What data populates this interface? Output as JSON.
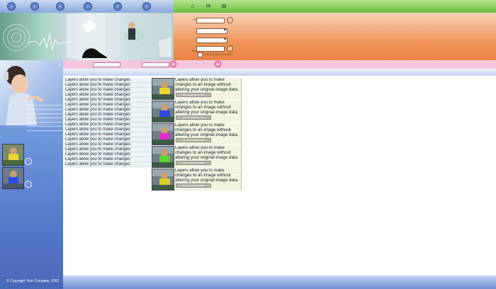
{
  "top_nav": {
    "left_icons": [
      "circle-arrow-icon",
      "circle-arrow-icon",
      "circle-arrow-icon",
      "circle-arrow-icon",
      "circle-arrow-icon",
      "circle-arrow-icon"
    ],
    "right_icons": [
      "home-icon",
      "mail-icon",
      "sitemap-icon"
    ]
  },
  "search_panel": {
    "search_label": "SEARCH",
    "genre_label": "GENRE",
    "letter_label": "LETTER",
    "subscribe_label": "SUBSCRIBE",
    "unsubscribe_label": "UNSUBSCRIBE",
    "search_value": "",
    "genre_selected": "",
    "letter_selected": "",
    "subscribe_value": ""
  },
  "pink_bar": {
    "field1_value": "",
    "field2_value": "",
    "field3_label": ""
  },
  "list": {
    "items": [
      "Layers allow you to make changes",
      "Layers allow you to make changes",
      "Layers allow you to make changes",
      "Layers allow you to make changes",
      "Layers allow you to make changes",
      "Layers allow you to make changes",
      "Layers allow you to make changes",
      "Layers allow you to make changes",
      "Layers allow you to make changes",
      "Layers allow you to make changes",
      "Layers allow you to make changes",
      "Layers allow you to make changes",
      "Layers allow you to make changes",
      "Layers allow you to make changes",
      "Layers allow you to make changes",
      "Layers allow you to make changes",
      "Layers allow you to make changes",
      "Layers allow you to make changes"
    ]
  },
  "cards": [
    {
      "text": "Layers allow you to make changes to an image without altering your original image data.",
      "more": "GO TO DOWNLOADS",
      "shirt": "#e7d82a"
    },
    {
      "text": "Layers allow you to make changes to an image without altering your original image data.",
      "more": "GO TO DOWNLOADS",
      "shirt": "#2d4ce6"
    },
    {
      "text": "Layers allow you to make changes to an image without altering your original image data.",
      "more": "GO TO DOWNLOADS",
      "shirt": "#e02fd0"
    },
    {
      "text": "Layers allow you to make changes to an image without altering your original image data.",
      "more": "GO TO DOWNLOADS",
      "shirt": "#5bd630"
    },
    {
      "text": "Layers allow you to make changes to an image without altering your original image data.",
      "more": "GO TO DOWNLOADS",
      "shirt": "#d7d02c"
    }
  ],
  "sidebar": {
    "thumbs": [
      {
        "shirt": "#e7d82a"
      },
      {
        "shirt": "#2d4ce6"
      }
    ]
  },
  "footer": {
    "copyright": "© Copyright Your Company, 2002"
  },
  "colors": {
    "top_left": "#8aa8dc",
    "top_right": "#6cbd40",
    "search_panel": "#f0965c",
    "sidebar": "#6f95db",
    "pink_bar": "#f6c6df",
    "list_bg": "#ecf5f5",
    "card_bg": "#f3f3e1"
  }
}
